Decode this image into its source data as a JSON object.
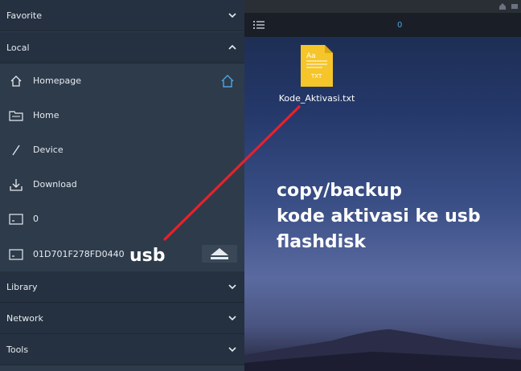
{
  "sidebar": {
    "sections": [
      {
        "label": "Favorite",
        "expanded": false
      },
      {
        "label": "Local",
        "expanded": true
      },
      {
        "label": "Library",
        "expanded": false
      },
      {
        "label": "Network",
        "expanded": false
      },
      {
        "label": "Tools",
        "expanded": false
      }
    ],
    "items": [
      {
        "label": "Homepage",
        "icon": "home-icon"
      },
      {
        "label": "Home",
        "icon": "folder-icon"
      },
      {
        "label": "Device",
        "icon": "slash-icon"
      },
      {
        "label": "Download",
        "icon": "download-icon"
      },
      {
        "label": "0",
        "icon": "sdcard-icon"
      },
      {
        "label": "01D701F278FD0440",
        "icon": "sdcard-icon"
      }
    ]
  },
  "annotations": {
    "usb": "usb",
    "caption_lines": [
      "copy/backup",
      "kode aktivasi ke usb",
      "flashdisk"
    ]
  },
  "main": {
    "tab_count": "0",
    "file": {
      "name": "Kode_Aktivasi.txt",
      "type_badge": "TXT"
    }
  },
  "colors": {
    "sidebar_bg": "#2e3b4b",
    "header_bg": "#253140",
    "accent": "#4fa3e0",
    "annotation_line": "#e8212a",
    "file_icon": "#f5c52a"
  }
}
